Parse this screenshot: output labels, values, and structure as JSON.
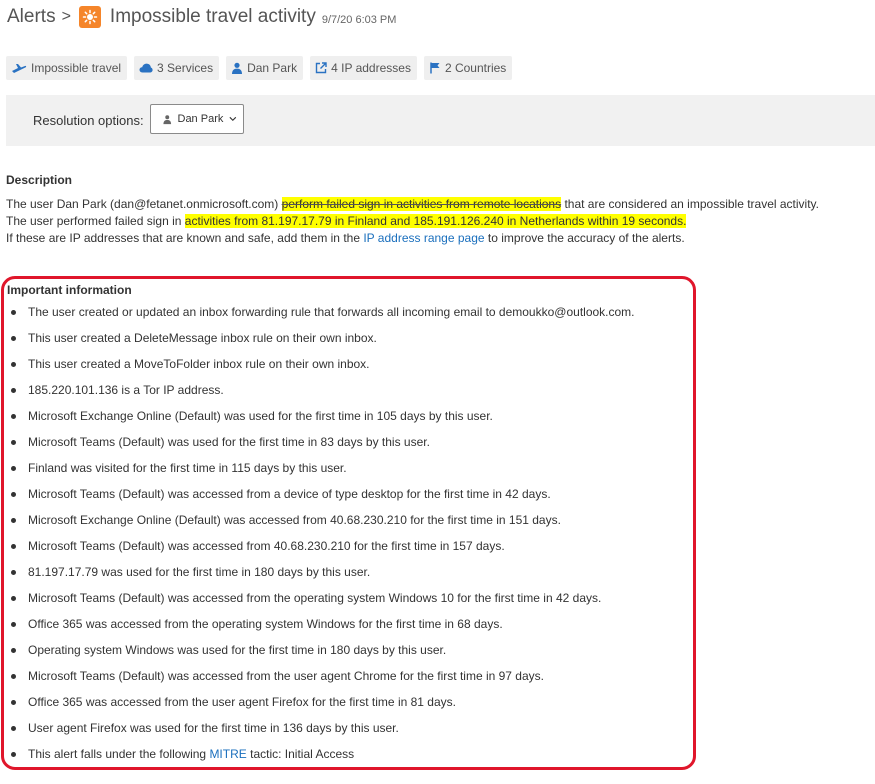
{
  "header": {
    "breadcrumb_root": "Alerts",
    "breadcrumb_sep": ">",
    "title": "Impossible travel activity",
    "timestamp": "9/7/20 6:03 PM"
  },
  "chips": [
    {
      "label": "Impossible travel"
    },
    {
      "label": "3 Services"
    },
    {
      "label": "Dan Park"
    },
    {
      "label": "4 IP addresses"
    },
    {
      "label": "2 Countries"
    }
  ],
  "resolution": {
    "label": "Resolution options:",
    "selected": "Dan Park"
  },
  "description": {
    "heading": "Description",
    "line1": {
      "before": "The user Dan Park (dan@fetanet.onmicrosoft.com)",
      "highlight": "perform failed sign in activities from remote locations",
      "after": "that are considered an impossible travel activity."
    },
    "line2": {
      "before": "The user performed failed sign in",
      "highlight": "activities from 81.197.17.79 in Finland and 185.191.126.240 in Netherlands within 19 seconds."
    },
    "line3": {
      "before": "If these are IP addresses that are known and safe, add them in the",
      "link": "IP address range page",
      "after": "to improve the accuracy of the alerts."
    }
  },
  "important": {
    "heading": "Important information",
    "items": [
      "The user created or updated an inbox forwarding rule that forwards all incoming email to demoukko@outlook.com.",
      "This user created a DeleteMessage inbox rule on their own inbox.",
      "This user created a MoveToFolder inbox rule on their own inbox.",
      "185.220.101.136 is a Tor IP address.",
      "Microsoft Exchange Online (Default) was used for the first time in 105 days by this user.",
      "Microsoft Teams (Default) was used for the first time in 83 days by this user.",
      "Finland was visited for the first time in 115 days by this user.",
      "Microsoft Teams (Default) was accessed from a device of type desktop for the first time in 42 days.",
      "Microsoft Exchange Online (Default) was accessed from 40.68.230.210 for the first time in 151 days.",
      "Microsoft Teams (Default) was accessed from 40.68.230.210 for the first time in 157 days.",
      "81.197.17.79 was used for the first time in 180 days by this user.",
      "Microsoft Teams (Default) was accessed from the operating system Windows 10 for the first time in 42 days.",
      "Office 365 was accessed from the operating system Windows for the first time in 68 days.",
      "Operating system Windows was used for the first time in 180 days by this user.",
      "Microsoft Teams (Default) was accessed from the user agent Chrome for the first time in 97 days.",
      "Office 365 was accessed from the user agent Firefox for the first time in 81 days.",
      "User agent Firefox was used for the first time in 136 days by this user."
    ],
    "last_item": {
      "before": "This alert falls under the following",
      "link": "MITRE",
      "after": "tactic: Initial Access"
    }
  },
  "colors": {
    "accent_link": "#1a6fbd",
    "alert_icon": "#f5852a",
    "highlight": "#ffff00",
    "annotation_frame": "#e0162b"
  }
}
